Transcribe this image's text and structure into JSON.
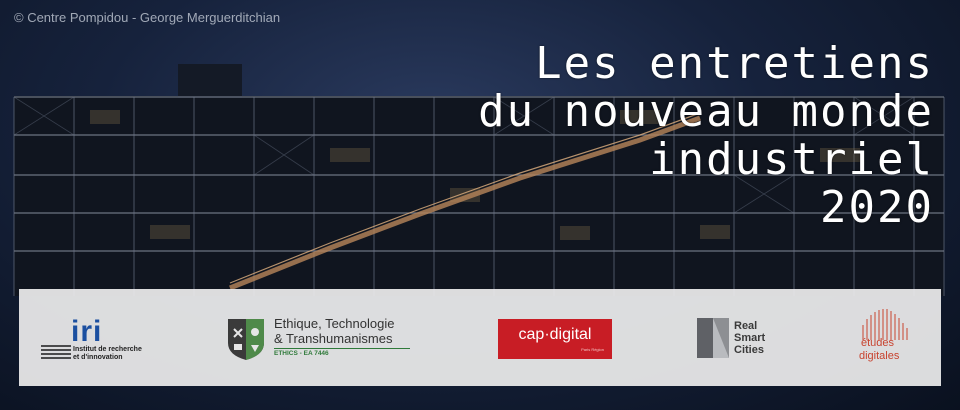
{
  "banner": {
    "credit": "©  Centre Pompidou - George Merguerditchian",
    "title_lines": [
      "Les entretiens",
      "du nouveau monde",
      "industriel",
      "2020"
    ]
  },
  "logos": {
    "iri": {
      "mark": "iri",
      "sub_line1": "Institut de recherche",
      "sub_line2": "et d'innovation"
    },
    "ethics": {
      "name_line1": "Ethique, Technologie",
      "name_line2": "& Transhumanismes",
      "code": "ETHICS - EA 7446"
    },
    "cap_digital": {
      "word": "cap·digital",
      "tiny": "Paris Région"
    },
    "real_smart_cities": {
      "line1": "Real",
      "line2": "Smart",
      "line3": "Cities"
    },
    "etudes_digitales": {
      "line1": "études",
      "line2": "digitales"
    }
  },
  "colors": {
    "iri_blue": "#1b4fa0",
    "cap_red": "#c81d25",
    "ethics_green": "#2f7a3a",
    "etudes_red": "#c8432f"
  }
}
